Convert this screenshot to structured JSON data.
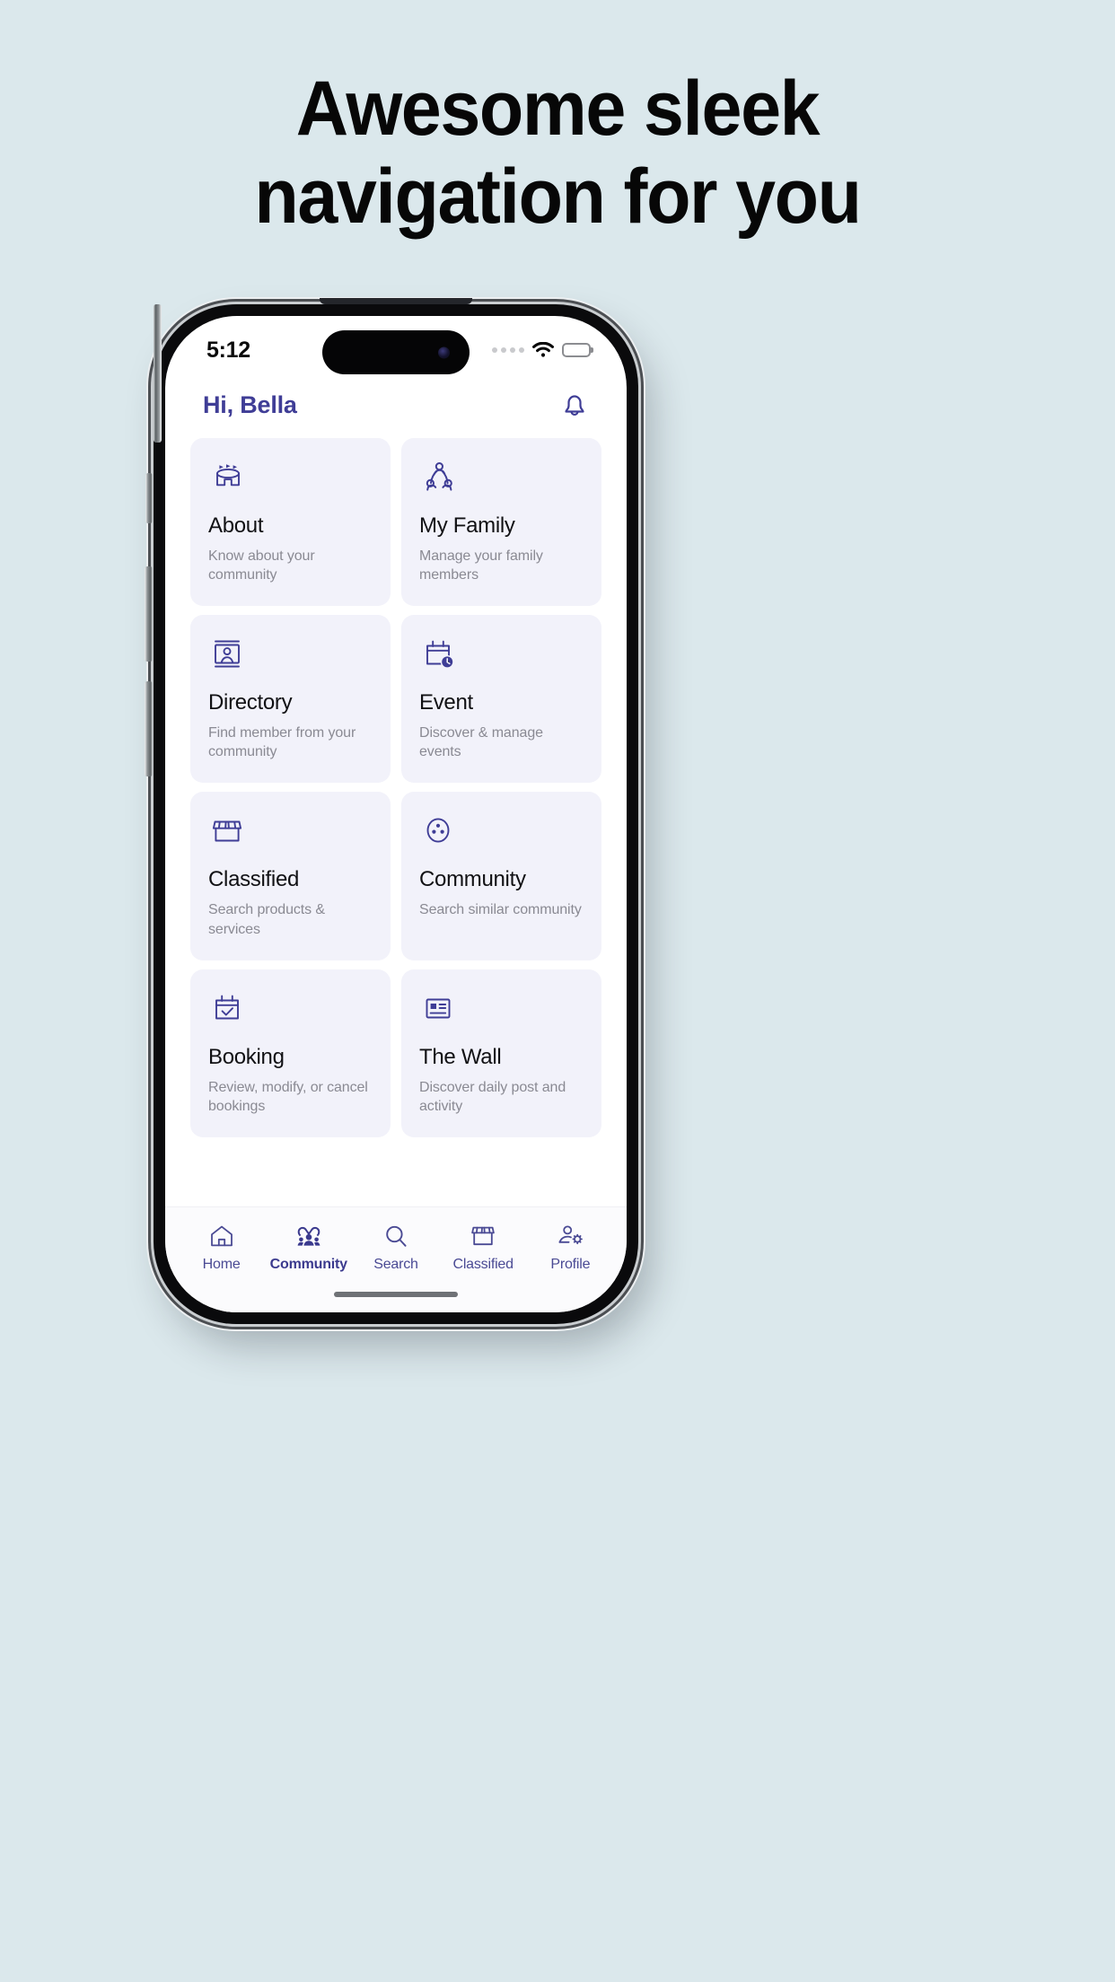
{
  "promo": {
    "headline_line1": "Awesome sleek",
    "headline_line2": "navigation for you",
    "background_color": "#dbe8ec",
    "headline_color": "#070707"
  },
  "theme": {
    "accent": "#3f3d96",
    "card_bg": "#f2f2fa",
    "screen_bg": "#ffffff",
    "title_color": "#111114",
    "desc_color": "#8a8a93",
    "tab_color": "#4a4a94"
  },
  "status_bar": {
    "time": "5:12",
    "signal_dots": 4,
    "wifi_icon": "wifi-icon",
    "battery_icon": "battery-full-icon",
    "battery_level": "100"
  },
  "app_header": {
    "greeting": "Hi, Bella",
    "notification_icon": "bell-icon"
  },
  "cards": [
    {
      "icon": "community-dome-icon",
      "title": "About",
      "desc": "Know about your community"
    },
    {
      "icon": "family-group-icon",
      "title": "My Family",
      "desc": "Manage your family members"
    },
    {
      "icon": "contact-card-icon",
      "title": "Directory",
      "desc": "Find member from your community"
    },
    {
      "icon": "calendar-clock-icon",
      "title": "Event",
      "desc": "Discover & manage events"
    },
    {
      "icon": "storefront-icon",
      "title": "Classified",
      "desc": "Search products & services"
    },
    {
      "icon": "circle-dots-icon",
      "title": "Community",
      "desc": "Search similar community"
    },
    {
      "icon": "calendar-check-icon",
      "title": "Booking",
      "desc": "Review, modify, or cancel bookings"
    },
    {
      "icon": "id-card-icon",
      "title": "The Wall",
      "desc": "Discover daily post and activity"
    }
  ],
  "tabbar": {
    "active_index": 1,
    "items": [
      {
        "icon": "home-icon",
        "label": "Home"
      },
      {
        "icon": "community-people-heart-icon",
        "label": "Community"
      },
      {
        "icon": "search-icon",
        "label": "Search"
      },
      {
        "icon": "storefront-icon",
        "label": "Classified"
      },
      {
        "icon": "profile-gear-icon",
        "label": "Profile"
      }
    ]
  }
}
